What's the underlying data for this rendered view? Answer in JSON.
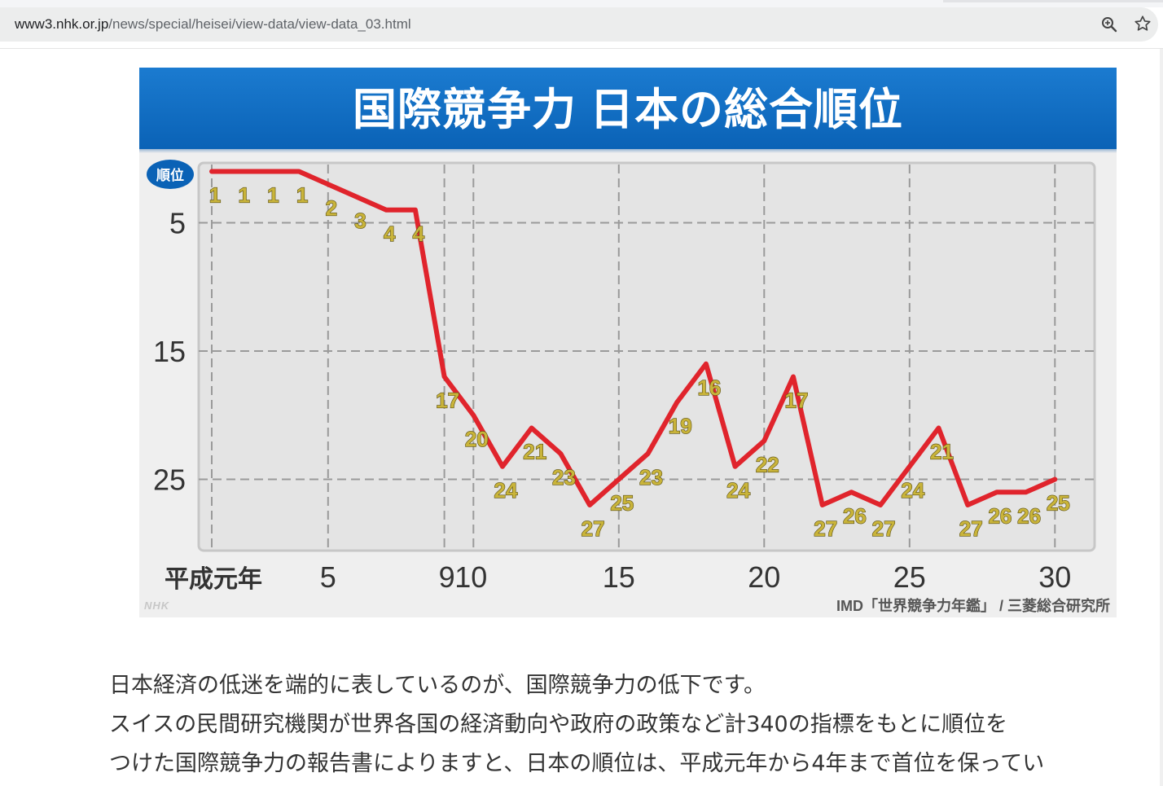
{
  "browser": {
    "url_host": "www3.nhk.or.jp",
    "url_path": "/news/special/heisei/view-data/view-data_03.html",
    "zoom_icon": "magnifier-zoom-icon",
    "bookmark_icon": "star-icon"
  },
  "figure": {
    "title": "国際競争力 日本の総合順位",
    "logo": "NHK",
    "source": "IMD「世界競争力年鑑」 / 三菱総合研究所",
    "colors": {
      "banner": "#0a62b6",
      "line": "#e0242c",
      "label": "#c9b43a"
    }
  },
  "chart_data": {
    "type": "line",
    "title": "国際競争力 日本の総合順位",
    "ylabel": "順位",
    "xlabel": "",
    "y_inverted": true,
    "ylim": [
      1,
      27
    ],
    "yticks": [
      5,
      15,
      25
    ],
    "xticks": [
      {
        "x": 1,
        "label": "平成元年"
      },
      {
        "x": 5,
        "label": "5"
      },
      {
        "x": 9,
        "label": "9"
      },
      {
        "x": 10,
        "label": "10"
      },
      {
        "x": 15,
        "label": "15"
      },
      {
        "x": 20,
        "label": "20"
      },
      {
        "x": 25,
        "label": "25"
      },
      {
        "x": 30,
        "label": "30"
      }
    ],
    "grid": true,
    "x": [
      1,
      2,
      3,
      4,
      5,
      6,
      7,
      8,
      9,
      10,
      11,
      12,
      13,
      14,
      15,
      16,
      17,
      18,
      19,
      20,
      21,
      22,
      23,
      24,
      25,
      26,
      27,
      28,
      29,
      30
    ],
    "values": [
      1,
      1,
      1,
      1,
      2,
      3,
      4,
      4,
      17,
      20,
      24,
      21,
      23,
      27,
      25,
      23,
      19,
      16,
      24,
      22,
      17,
      27,
      26,
      27,
      24,
      21,
      27,
      26,
      26,
      25
    ]
  },
  "article": {
    "lines": [
      "日本経済の低迷を端的に表しているのが、国際競争力の低下です。",
      "スイスの民間研究機関が世界各国の経済動向や政府の政策など計340の指標をもとに順位を",
      "つけた国際競争力の報告書によりますと、日本の順位は、平成元年から4年まで首位を保ってい"
    ]
  }
}
